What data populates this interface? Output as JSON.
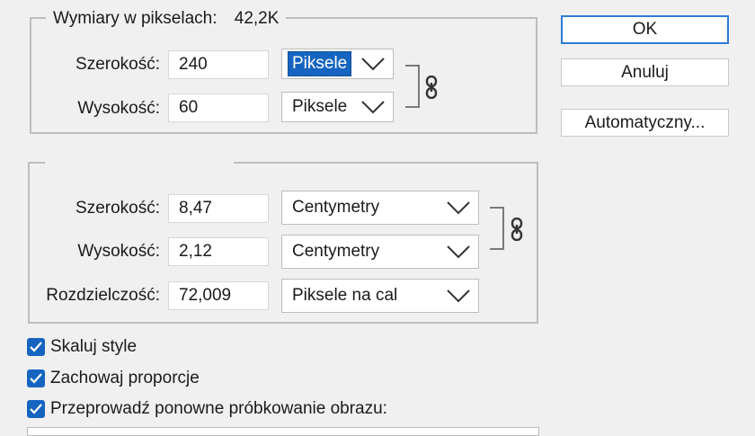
{
  "pixel_dimensions": {
    "legend_label": "Wymiary w pikselach:",
    "legend_value": "42,2K",
    "width_label": "Szerokość:",
    "width_value": "240",
    "width_unit": "Piksele",
    "height_label": "Wysokość:",
    "height_value": "60",
    "height_unit": "Piksele"
  },
  "document_size": {
    "legend_label": "",
    "width_label": "Szerokość:",
    "width_value": "8,47",
    "width_unit": "Centymetry",
    "height_label": "Wysokość:",
    "height_value": "2,12",
    "height_unit": "Centymetry",
    "resolution_label": "Rozdzielczość:",
    "resolution_value": "72,009",
    "resolution_unit": "Piksele na cal"
  },
  "buttons": {
    "ok": "OK",
    "cancel": "Anuluj",
    "auto": "Automatyczny..."
  },
  "options": {
    "scale_styles": "Skaluj style",
    "constrain_proportions": "Zachowaj proporcje",
    "resample": "Przeprowadź ponowne próbkowanie obrazu:"
  },
  "colors": {
    "accent": "#1565c0",
    "background": "#f0f0f0"
  },
  "icons": {
    "dropdown": "chevron-down-icon",
    "link": "chain-link-icon",
    "check": "checkmark-icon"
  }
}
